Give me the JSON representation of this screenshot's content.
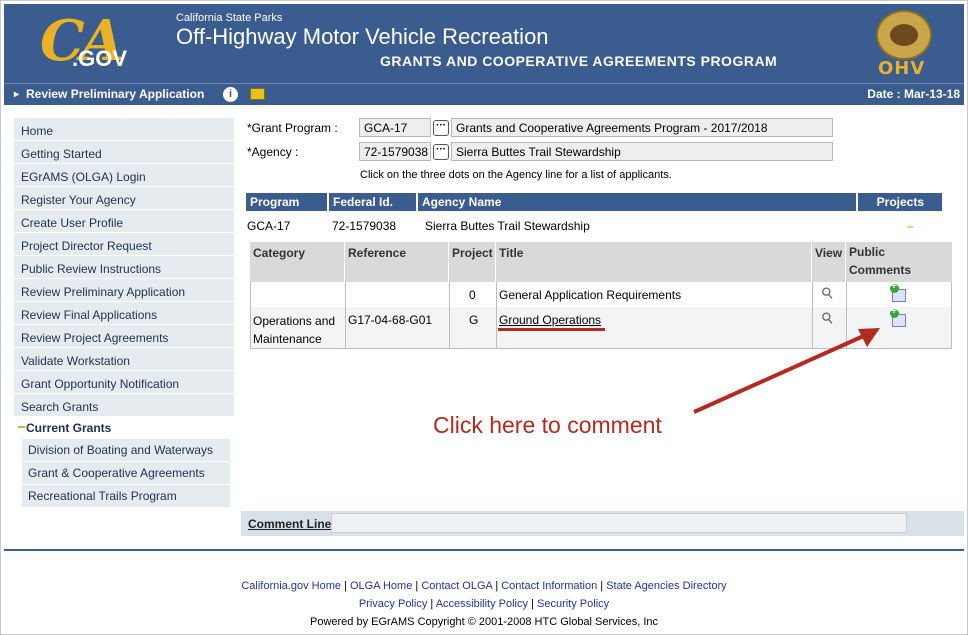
{
  "header": {
    "logo_ca": "CA",
    "logo_gov": ".GOV",
    "agency_small": "California State Parks",
    "app_title": "Off-Highway Motor Vehicle Recreation",
    "program_title": "GRANTS AND COOPERATIVE AGREEMENTS PROGRAM",
    "seal_text": "OHV"
  },
  "navbar": {
    "arrow": "▸",
    "page_title": "Review Preliminary Application",
    "info_glyph": "i",
    "date": "Date : Mar-13-18"
  },
  "sidebar": {
    "items": [
      "Home",
      "Getting Started",
      "EGrAMS (OLGA) Login",
      "Register Your Agency",
      "Create User Profile",
      "Project Director Request",
      "Public Review Instructions",
      "Review Preliminary Application",
      "Review Final Applications",
      "Review Project Agreements",
      "Validate Workstation",
      "Grant Opportunity Notification",
      "Search Grants"
    ],
    "current_heading": "Current Grants",
    "sub_items": [
      "Division of Boating and Waterways",
      "Grant & Cooperative Agreements",
      "Recreational Trails Program"
    ]
  },
  "form": {
    "grant_program_label": "*Grant Program :",
    "grant_program_code": "GCA-17",
    "grant_program_name": "Grants and Cooperative Agreements Program - 2017/2018",
    "agency_label": "*Agency :",
    "agency_code": "72-1579038",
    "agency_name": "Sierra Buttes Trail Stewardship",
    "dots": "···",
    "hint": "Click on the three dots on the Agency line for a list of applicants."
  },
  "agency_table": {
    "headers": [
      "Program",
      "Federal Id.",
      "Agency Name",
      "Projects"
    ],
    "row": [
      "GCA-17",
      "72-1579038",
      "Sierra Buttes Trail Stewardship",
      "–"
    ]
  },
  "projects_table": {
    "headers": [
      "Category",
      "Reference",
      "Project",
      "Title",
      "View",
      "Public Comments"
    ],
    "rows": [
      [
        "",
        "",
        "0",
        "General Application Requirements"
      ],
      [
        "Operations and Maintenance",
        "G17-04-68-G01",
        "G",
        "Ground Operations"
      ]
    ]
  },
  "annotation": {
    "callout": "Click here to comment",
    "color": "#b42a1e"
  },
  "comment_line": {
    "label": "Comment Line:",
    "value": ""
  },
  "footer": {
    "links_row1": [
      "California.gov Home",
      "OLGA Home",
      "Contact OLGA",
      "Contact Information",
      "State Agencies Directory"
    ],
    "links_row2": [
      "Privacy Policy",
      "Accessibility Policy",
      "Security Policy"
    ],
    "separator": "|",
    "powered_by": "Powered by EGrAMS Copyright © 2001-2008 HTC Global Services, Inc"
  },
  "colors": {
    "brand_blue": "#3b5c8f",
    "gold": "#e8b224",
    "sidebar_bg": "#e6ebef"
  }
}
